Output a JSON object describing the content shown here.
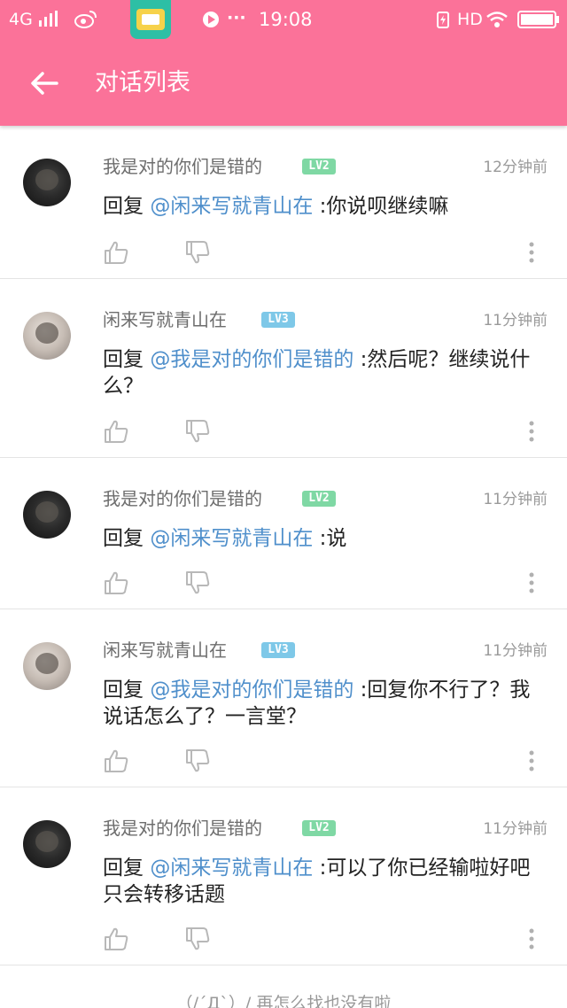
{
  "status_bar": {
    "network": "4G",
    "time": "19:08",
    "hd": "HD",
    "more_dots": "···"
  },
  "app_bar": {
    "title": "对话列表"
  },
  "comments": [
    {
      "username": "我是对的你们是错的",
      "level": "LV2",
      "time": "12分钟前",
      "reply_prefix": "回复 ",
      "mention": "@闲来写就青山在",
      "text": " :你说呗继续嘛"
    },
    {
      "username": "闲来写就青山在",
      "level": "LV3",
      "time": "11分钟前",
      "reply_prefix": "回复 ",
      "mention": "@我是对的你们是错的",
      "text": " :然后呢？继续说什么？"
    },
    {
      "username": "我是对的你们是错的",
      "level": "LV2",
      "time": "11分钟前",
      "reply_prefix": "回复 ",
      "mention": "@闲来写就青山在",
      "text": " :说"
    },
    {
      "username": "闲来写就青山在",
      "level": "LV3",
      "time": "11分钟前",
      "reply_prefix": "回复 ",
      "mention": "@我是对的你们是错的",
      "text": " :回复你不行了？我说话怎么了？一言堂？"
    },
    {
      "username": "我是对的你们是错的",
      "level": "LV2",
      "time": "11分钟前",
      "reply_prefix": "回复 ",
      "mention": "@闲来写就青山在",
      "text": " :可以了你已经输啦好吧只会转移话题"
    }
  ],
  "footer": {
    "text": "（/´Д`）/ 再怎么找也没有啦"
  },
  "colors": {
    "brand_pink": "#fb7299",
    "mention_blue": "#4f8fcb",
    "lv2_green": "#7fd8a4",
    "lv3_blue": "#7ec8e8"
  },
  "icons": [
    "back-arrow-icon",
    "thumbs-up-icon",
    "thumbs-down-icon",
    "more-vertical-icon",
    "weibo-icon",
    "wifi-icon",
    "battery-icon",
    "signal-icon"
  ]
}
